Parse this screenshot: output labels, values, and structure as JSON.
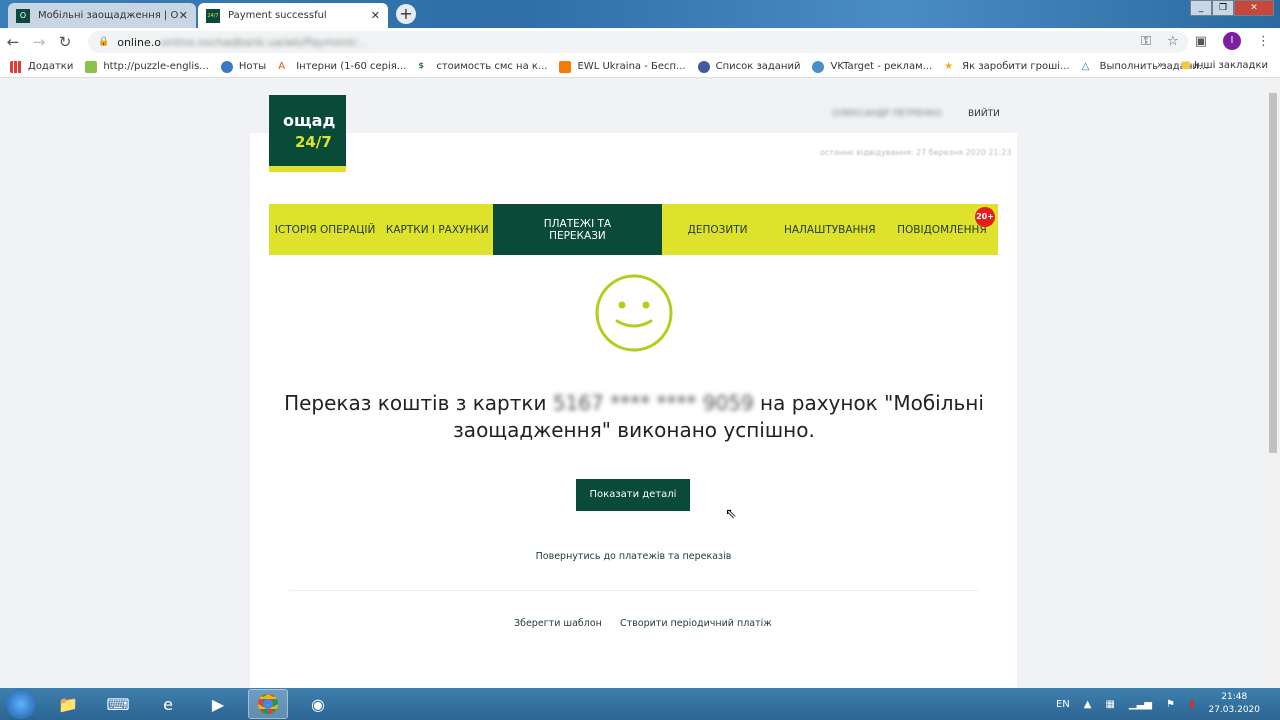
{
  "browser": {
    "tabs": [
      {
        "title": "Мобільні заощадження | Ощад",
        "favicon": "О"
      },
      {
        "title": "Payment successful",
        "favicon": "24/7",
        "active": true
      }
    ],
    "url": "online.oschadbank.ua/wb/Payment/...",
    "bookmarks": [
      "Додатки",
      "http://puzzle-englis...",
      "Ноты",
      "Інтерни (1-60 серія...",
      "стоимость смс на к...",
      "EWL Ukraina - Бесп...",
      "Список заданий",
      "VKTarget - реклам...",
      "Як заробити гроші...",
      "Выполнить задани..."
    ],
    "bookmarks_more": "»",
    "other_bookmarks": "Інші закладки",
    "profile_initial": "I"
  },
  "header": {
    "logo_top": "ощад",
    "logo_bottom": "24/7",
    "user_name": "ОЛЕКСАНДР ПЕТРЕНКО",
    "logout": "ВИЙТИ",
    "last_visit": "останнє відвідування: 27 березня 2020 21:23"
  },
  "menu": {
    "items": [
      {
        "label": "ІСТОРІЯ ОПЕРАЦІЙ"
      },
      {
        "label": "КАРТКИ І РАХУНКИ"
      },
      {
        "label": "ПЛАТЕЖІ ТА ПЕРЕКАЗИ",
        "active": true
      },
      {
        "label": "ДЕПОЗИТИ"
      },
      {
        "label": "НАЛАШТУВАННЯ"
      },
      {
        "label": "ПОВІДОМЛЕННЯ",
        "badge": "20+"
      }
    ]
  },
  "main": {
    "icon": "smiley-icon",
    "msg_before": "Переказ коштів з картки ",
    "card_number": "5167 **** **** 9059",
    "msg_after": " на рахунок \"Мобільні заощадження\" виконано успішно.",
    "details_button": "Показати деталі",
    "back_link": "Повернутись до платежів та переказів",
    "save_template": "Зберегти шаблон",
    "create_periodic": "Створити періодичний платіж"
  },
  "colors": {
    "brand_dark": "#0a4a39",
    "brand_yellow": "#dfe22a",
    "smile": "#b5cc1a",
    "badge": "#e61e1e"
  },
  "taskbar": {
    "lang": "EN",
    "time": "21:48",
    "date": "27.03.2020"
  }
}
